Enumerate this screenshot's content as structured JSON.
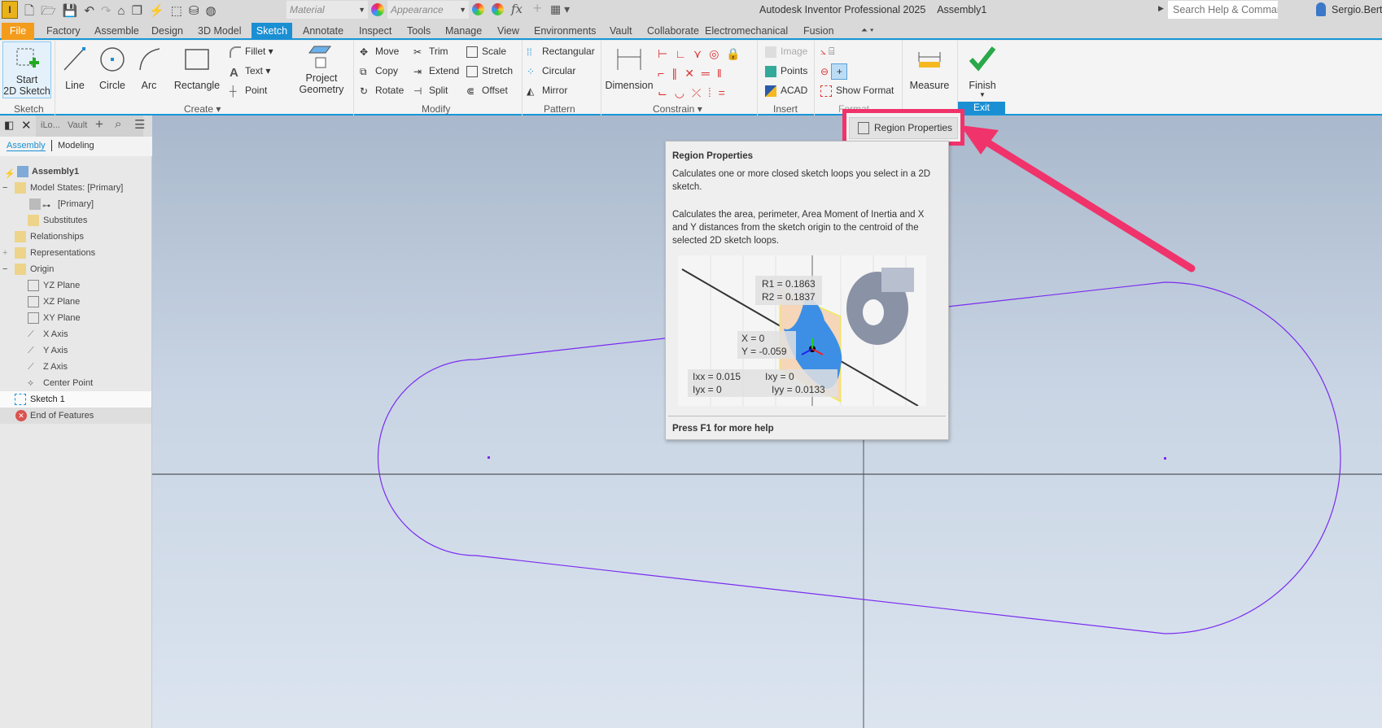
{
  "app": {
    "title": "Autodesk Inventor Professional 2025",
    "document": "Assembly1",
    "logo_letter": "I"
  },
  "qat": {
    "material": "Material",
    "appearance": "Appearance",
    "fx": "fx"
  },
  "search": {
    "placeholder": "Search Help & Commands..."
  },
  "user": {
    "name": "Sergio.Bert"
  },
  "tabs": [
    "File",
    "Factory",
    "Assemble",
    "Design",
    "3D Model",
    "Sketch",
    "Annotate",
    "Inspect",
    "Tools",
    "Manage",
    "View",
    "Environments",
    "Vault",
    "Collaborate",
    "Electromechanical",
    "Fusion"
  ],
  "active_tab": "Sketch",
  "ribbon": {
    "sketch": {
      "start": "Start",
      "start2": "2D Sketch",
      "label": "Sketch"
    },
    "create": {
      "line": "Line",
      "circle": "Circle",
      "arc": "Arc",
      "rectangle": "Rectangle",
      "fillet": "Fillet",
      "text": "Text",
      "point": "Point",
      "project": "Project",
      "project2": "Geometry",
      "label": "Create"
    },
    "modify": {
      "move": "Move",
      "copy": "Copy",
      "rotate": "Rotate",
      "trim": "Trim",
      "extend": "Extend",
      "split": "Split",
      "scale": "Scale",
      "stretch": "Stretch",
      "offset": "Offset",
      "label": "Modify"
    },
    "pattern": {
      "rectangular": "Rectangular",
      "circular": "Circular",
      "mirror": "Mirror",
      "label": "Pattern"
    },
    "constrain": {
      "dimension": "Dimension",
      "label": "Constrain"
    },
    "insert": {
      "image": "Image",
      "points": "Points",
      "acad": "ACAD",
      "label": "Insert"
    },
    "format": {
      "show_format": "Show Format",
      "label": "Format"
    },
    "measure": {
      "label": "Measure"
    },
    "exit": {
      "finish": "Finish",
      "label": "Exit"
    }
  },
  "region_button": {
    "label": "Region Properties"
  },
  "tooltip": {
    "title": "Region Properties",
    "p1": "Calculates one or more closed sketch loops you select in a 2D sketch.",
    "p2": "Calculates the area, perimeter, Area Moment of Inertia and X and Y distances from the sketch origin to the centroid of the selected 2D sketch loops.",
    "img": {
      "r1": "R1 = 0.1863",
      "r2": "R2 = 0.1837",
      "x": "X = 0",
      "y": "Y = -0.059",
      "ixx": "Ixx = 0.015",
      "ixy": "Ixy = 0",
      "iyx": "Iyx = 0",
      "iyy": "Iyy = 0.0133"
    },
    "footer": "Press F1 for more help"
  },
  "browser": {
    "tabs": [
      "iLo...",
      "Vault"
    ],
    "modes": [
      "Assembly",
      "Modeling"
    ],
    "tree": [
      "Assembly1",
      "Model States: [Primary]",
      "[Primary]",
      "Substitutes",
      "Relationships",
      "Representations",
      "Origin",
      "YZ Plane",
      "XZ Plane",
      "XY Plane",
      "X Axis",
      "Y Axis",
      "Z Axis",
      "Center Point",
      "Sketch 1",
      "End of Features"
    ]
  },
  "colors": {
    "accent": "#1b8fd3",
    "file_tab": "#f39b1b",
    "highlight": "#f0336b",
    "sketch": "#7a2cf0"
  }
}
